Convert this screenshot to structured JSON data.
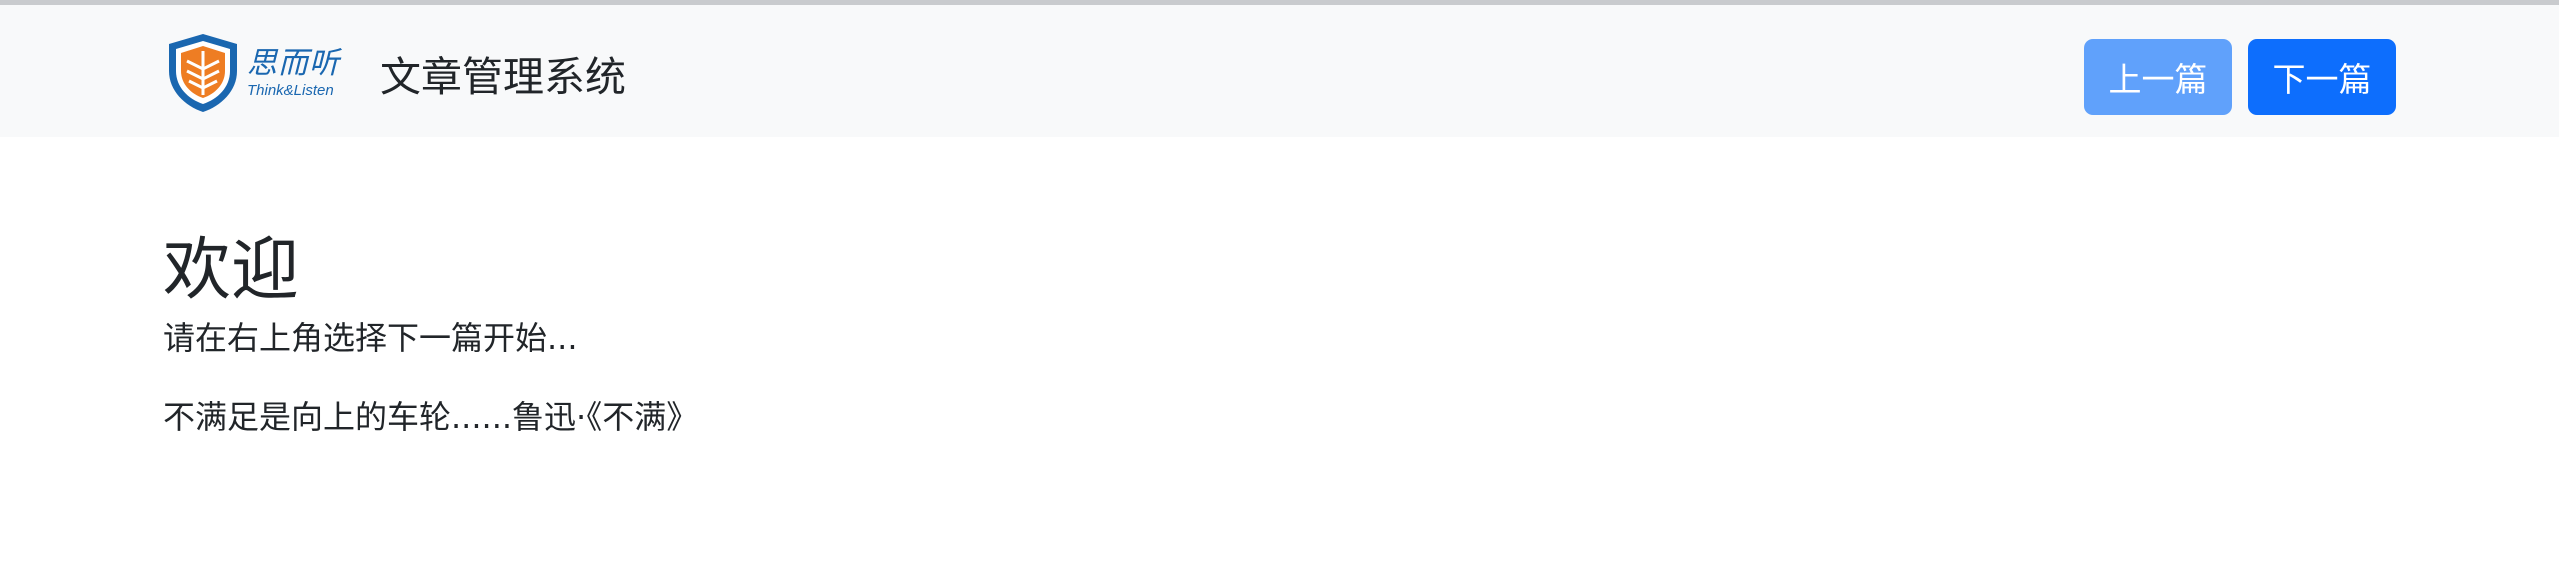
{
  "navbar": {
    "logo": {
      "cn_text": "思而听",
      "en_text": "Think&Listen",
      "shield_color": "#1a67b0",
      "accent_color": "#ee7d23"
    },
    "title": "文章管理系统",
    "prev_button": "上一篇",
    "next_button": "下一篇"
  },
  "main": {
    "heading": "欢迎",
    "subtitle": "请在右上角选择下一篇开始...",
    "quote": "不满足是向上的车轮......鲁迅·《不满》"
  },
  "colors": {
    "primary": "#0d6efd",
    "primary_light": "#60a1fb",
    "navbar_bg": "#f8f9fa"
  }
}
